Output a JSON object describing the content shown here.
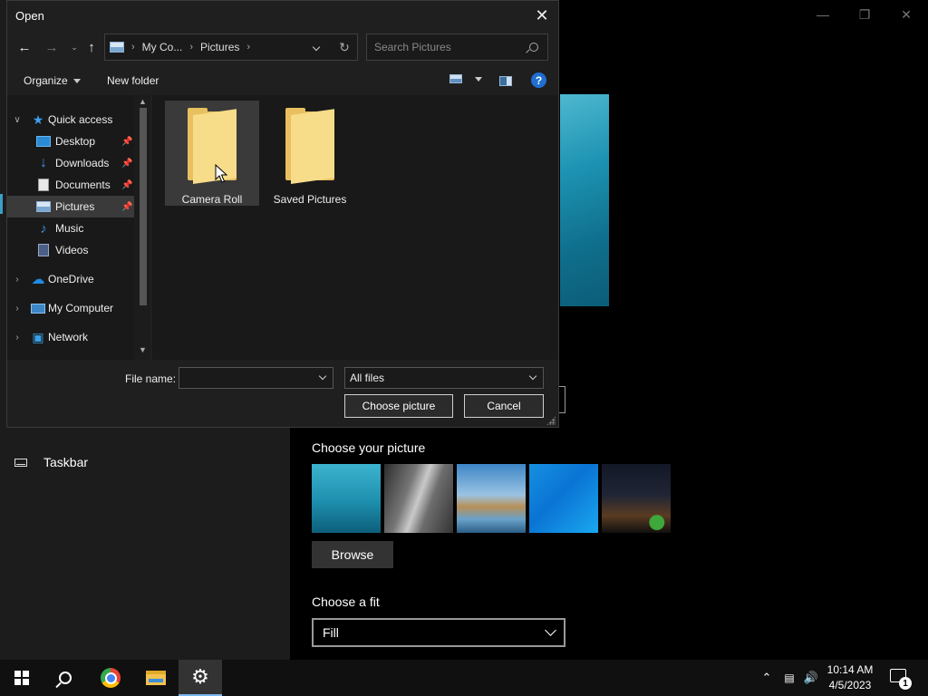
{
  "dialog": {
    "title": "Open",
    "address": {
      "crumb1": "My Co...",
      "crumb2": "Pictures"
    },
    "search_placeholder": "Search Pictures",
    "toolbar": {
      "organize": "Organize",
      "new_folder": "New folder"
    },
    "nav": {
      "quick_access": "Quick access",
      "items": [
        {
          "label": "Desktop",
          "icon": "desktop-icon",
          "pinned": true
        },
        {
          "label": "Downloads",
          "icon": "download-icon",
          "pinned": true
        },
        {
          "label": "Documents",
          "icon": "document-icon",
          "pinned": true
        },
        {
          "label": "Pictures",
          "icon": "pictures-icon",
          "pinned": true,
          "selected": true
        },
        {
          "label": "Music",
          "icon": "music-icon"
        },
        {
          "label": "Videos",
          "icon": "video-icon"
        }
      ],
      "onedrive": "OneDrive",
      "my_computer": "My Computer",
      "network": "Network"
    },
    "folders": [
      {
        "label": "Camera Roll",
        "hovered": true
      },
      {
        "label": "Saved Pictures"
      }
    ],
    "file_name_label": "File name:",
    "file_name_value": "",
    "file_type": "All files",
    "choose_button": "Choose picture",
    "cancel_button": "Cancel"
  },
  "settings": {
    "nav_taskbar": "Taskbar",
    "choose_picture_label": "Choose your picture",
    "browse_button": "Browse",
    "choose_fit_label": "Choose a fit",
    "fit_value": "Fill"
  },
  "taskbar": {
    "time": "10:14 AM",
    "date": "4/5/2023",
    "notification_count": "1"
  },
  "colors": {
    "accent": "#3aa0c8",
    "dialog_bg": "#1f1f1f",
    "selection": "#3a3a3a"
  }
}
